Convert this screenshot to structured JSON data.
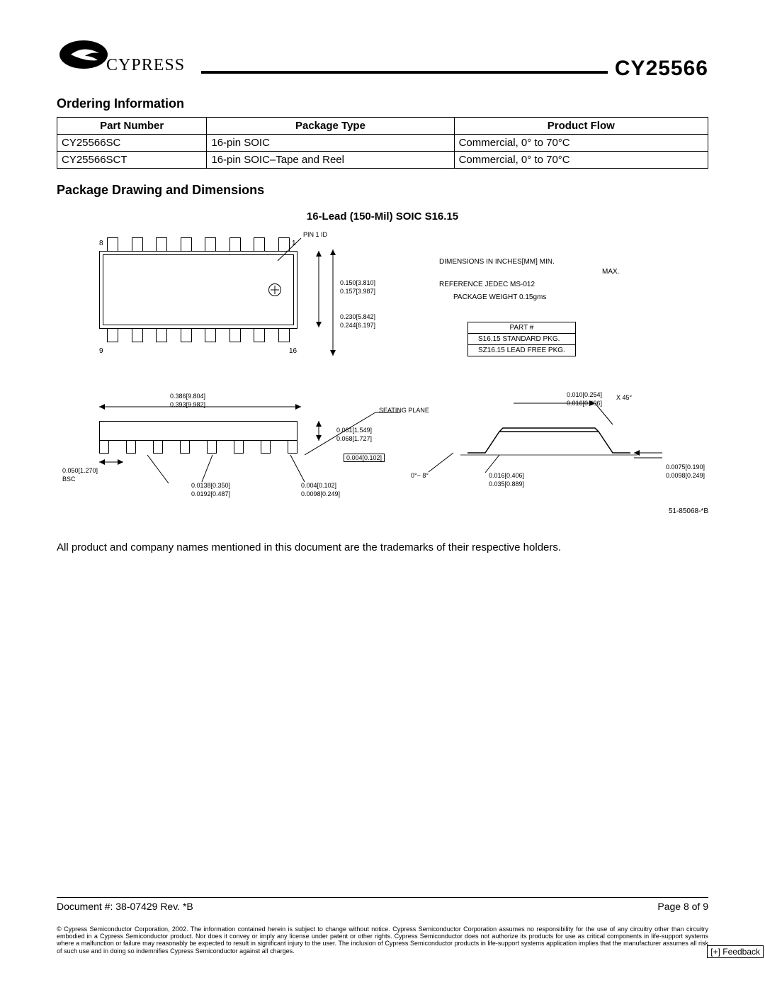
{
  "header": {
    "brand": "CYPRESS",
    "part_number": "CY25566"
  },
  "sections": {
    "ordering": "Ordering Information",
    "package": "Package Drawing and Dimensions"
  },
  "ordering_table": {
    "headers": [
      "Part Number",
      "Package Type",
      "Product Flow"
    ],
    "rows": [
      [
        "CY25566SC",
        "16-pin SOIC",
        "Commercial, 0° to 70°C"
      ],
      [
        "CY25566SCT",
        "16-pin SOIC–Tape and Reel",
        "Commercial, 0° to 70°C"
      ]
    ]
  },
  "package_title": "16-Lead (150-Mil) SOIC S16.15",
  "diagram": {
    "pin1_id": "PIN 1 ID",
    "pin_labels": {
      "tl": "8",
      "tr": "1",
      "bl": "9",
      "br": "16"
    },
    "dims_note1": "DIMENSIONS IN INCHES[MM] MIN.",
    "dims_note_max": "MAX.",
    "ref": "REFERENCE JEDEC MS-012",
    "weight": "PACKAGE WEIGHT 0.15gms",
    "part_table_header": "PART #",
    "part_table_rows": [
      "S16.15  STANDARD PKG.",
      "SZ16.15 LEAD FREE PKG."
    ],
    "dim_150": "0.150[3.810]",
    "dim_157": "0.157[3.987]",
    "dim_230": "0.230[5.842]",
    "dim_244": "0.244[6.197]",
    "dim_386": "0.386[9.804]",
    "dim_393": "0.393[9.982]",
    "seating": "SEATING PLANE",
    "dim_061": "0.061[1.549]",
    "dim_068": "0.068[1.727]",
    "dim_004a": "0.004[0.102]",
    "dim_050": "0.050[1.270]",
    "bsc": "BSC",
    "dim_0138": "0.0138[0.350]",
    "dim_0192": "0.0192[0.487]",
    "dim_004b": "0.004[0.102]",
    "dim_0098a": "0.0098[0.249]",
    "angle": "0°~ 8°",
    "dim_016": "0.016[0.406]",
    "dim_035": "0.035[0.889]",
    "dim_010": "0.010[0.254]",
    "dim_016b": "0.016[0.406]",
    "x45": "X 45°",
    "dim_0075": "0.0075[0.190]",
    "dim_0098b": "0.0098[0.249]",
    "drawing_no": "51-85068-*B"
  },
  "trademark_note": "All product and company names mentioned in this document are the trademarks of their respective holders.",
  "footer": {
    "doc": "Document #: 38-07429 Rev. *B",
    "page": "Page 8 of 9",
    "legal": "© Cypress Semiconductor Corporation, 2002. The information contained herein is subject to change without notice. Cypress Semiconductor Corporation assumes no responsibility for the use of any circuitry other than circuitry embodied in a Cypress Semiconductor product. Nor does it convey or imply any license under patent or other rights. Cypress Semiconductor does not authorize its products for use as critical components in life-support systems where a malfunction or failure may reasonably be expected to result in significant injury to the user. The inclusion of Cypress Semiconductor products in life-support systems application implies that the manufacturer assumes all risk of such use and in doing so indemnifies Cypress Semiconductor against all charges."
  },
  "feedback": "[+] Feedback"
}
